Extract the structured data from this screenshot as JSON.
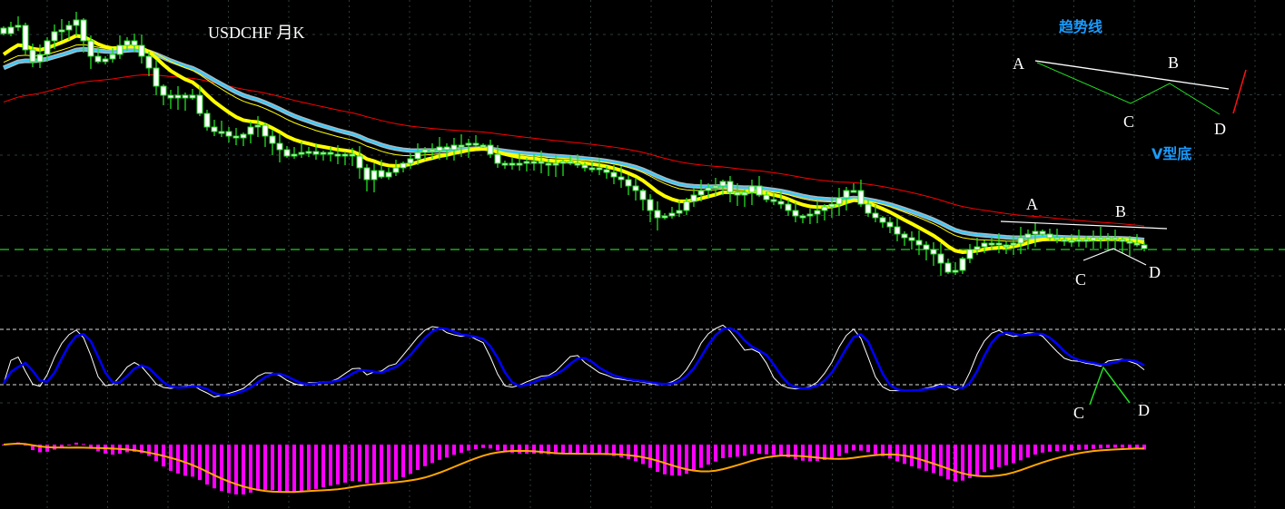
{
  "chart_data": {
    "type": "candlestick",
    "title": "USDCHF月K",
    "price_unit": "relative index (higher = higher price)",
    "closes": [
      303,
      310,
      312,
      285,
      272,
      280,
      295,
      305,
      307,
      312,
      318,
      295,
      278,
      272,
      275,
      280,
      290,
      295,
      290,
      278,
      265,
      245,
      235,
      232,
      235,
      232,
      235,
      215,
      200,
      195,
      195,
      190,
      188,
      192,
      200,
      202,
      190,
      182,
      175,
      168,
      170,
      172,
      173,
      170,
      172,
      170,
      168,
      170,
      168,
      155,
      142,
      152,
      145,
      150,
      155,
      160,
      165,
      172,
      175,
      174,
      178,
      175,
      180,
      180,
      182,
      180,
      180,
      170,
      160,
      160,
      160,
      160,
      162,
      162,
      160,
      158,
      160,
      162,
      160,
      158,
      155,
      155,
      153,
      150,
      145,
      142,
      135,
      130,
      120,
      108,
      100,
      102,
      105,
      108,
      118,
      125,
      130,
      133,
      135,
      140,
      128,
      125,
      128,
      135,
      125,
      120,
      118,
      115,
      108,
      102,
      102,
      104,
      108,
      112,
      115,
      122,
      130,
      130,
      115,
      105,
      100,
      95,
      90,
      82,
      78,
      75,
      70,
      65,
      60,
      50,
      40,
      42,
      55,
      65,
      68,
      72,
      72,
      70,
      70,
      72,
      78,
      82,
      85,
      82,
      78,
      76,
      74,
      75,
      76,
      75,
      78,
      76,
      78,
      76,
      74,
      72,
      70,
      66
    ],
    "moving_averages": [
      {
        "name": "fast",
        "period": 10,
        "seed": 275,
        "color": "#ffff00"
      },
      {
        "name": "medium",
        "period": 20,
        "seed": 268,
        "color": "#ffff00"
      },
      {
        "name": "slow",
        "period": 25,
        "seed": 262,
        "color": "#33ccff"
      },
      {
        "name": "long",
        "period": 60,
        "seed": 225,
        "color": "#ff0000"
      }
    ],
    "support_level": 65,
    "stochastic": {
      "k": 9,
      "d": 3,
      "slowing": 3,
      "levels": [
        80,
        20
      ],
      "k_color": "#ffffff",
      "d_color": "#0000ff"
    },
    "macd": {
      "fast": 12,
      "slow": 26,
      "signal": 9,
      "bar_color": "#ff00ff",
      "signal_color": "#ffa500"
    }
  },
  "annotations": {
    "title": "USDCHF 月K",
    "legend_title_trendline": "趋势线",
    "legend_title_vbottom": "V型底",
    "legend_A": "A",
    "legend_B": "B",
    "legend_C": "C",
    "legend_D": "D",
    "chart_A": "A",
    "chart_B": "B",
    "chart_C": "C",
    "chart_D": "D",
    "stoch_C": "C",
    "stoch_D": "D"
  }
}
